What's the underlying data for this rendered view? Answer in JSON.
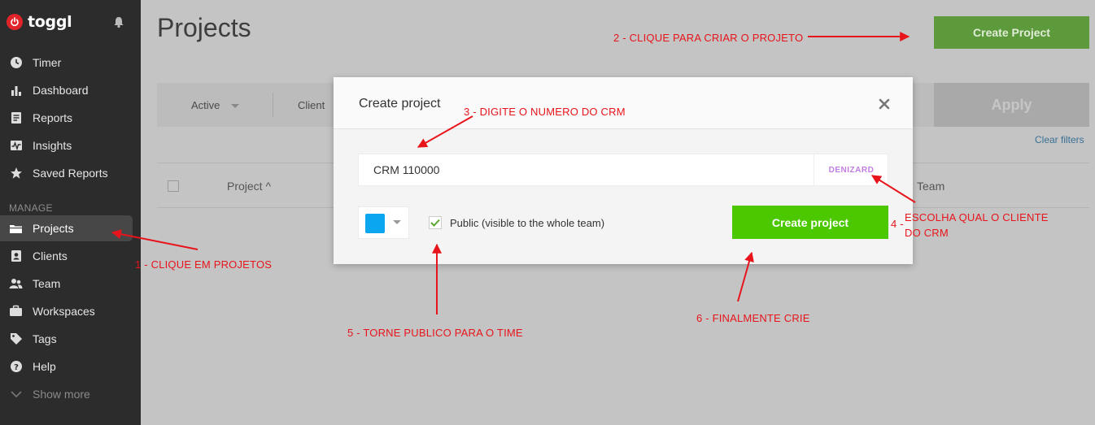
{
  "brand": {
    "name": "toggl"
  },
  "sidebar": {
    "items": [
      {
        "label": "Timer",
        "icon": "clock-icon"
      },
      {
        "label": "Dashboard",
        "icon": "bar-chart-icon"
      },
      {
        "label": "Reports",
        "icon": "document-icon"
      },
      {
        "label": "Insights",
        "icon": "pulse-icon"
      },
      {
        "label": "Saved Reports",
        "icon": "star-icon"
      }
    ],
    "manage_label": "MANAGE",
    "manage_items": [
      {
        "label": "Projects",
        "icon": "folder-icon",
        "active": true
      },
      {
        "label": "Clients",
        "icon": "contact-icon"
      },
      {
        "label": "Team",
        "icon": "team-icon"
      },
      {
        "label": "Workspaces",
        "icon": "briefcase-icon"
      },
      {
        "label": "Tags",
        "icon": "tag-icon"
      },
      {
        "label": "Help",
        "icon": "help-icon"
      },
      {
        "label": "Show more",
        "icon": "chevron-down-icon"
      }
    ]
  },
  "main": {
    "title": "Projects",
    "create_button": "Create Project",
    "filters": {
      "status": "Active",
      "client": "Client"
    },
    "apply_button": "Apply",
    "clear_filters": "Clear filters",
    "columns": {
      "project": "Project ^",
      "team": "Team"
    }
  },
  "modal": {
    "title": "Create project",
    "project_name_value": "CRM 110000",
    "client_value": "DENIZARD",
    "color": "#0aa6ef",
    "public_checked": true,
    "public_label": "Public (visible to the whole team)",
    "create_button": "Create project"
  },
  "annotations": {
    "a1": "1 - CLIQUE EM PROJETOS",
    "a2": "2 - CLIQUE PARA CRIAR O PROJETO",
    "a3": "3 -  DIGITE O NUMERO DO CRM",
    "a4_num": "4 -",
    "a4_line1": "ESCOLHA QUAL O CLIENTE",
    "a4_line2": "DO CRM",
    "a5": "5 - TORNE PUBLICO PARA O TIME",
    "a6": "6 - FINALMENTE CRIE"
  },
  "colors": {
    "accent_green": "#4bc800",
    "annotation_red": "#e8141b",
    "sidebar_bg": "#2c2c2c"
  }
}
